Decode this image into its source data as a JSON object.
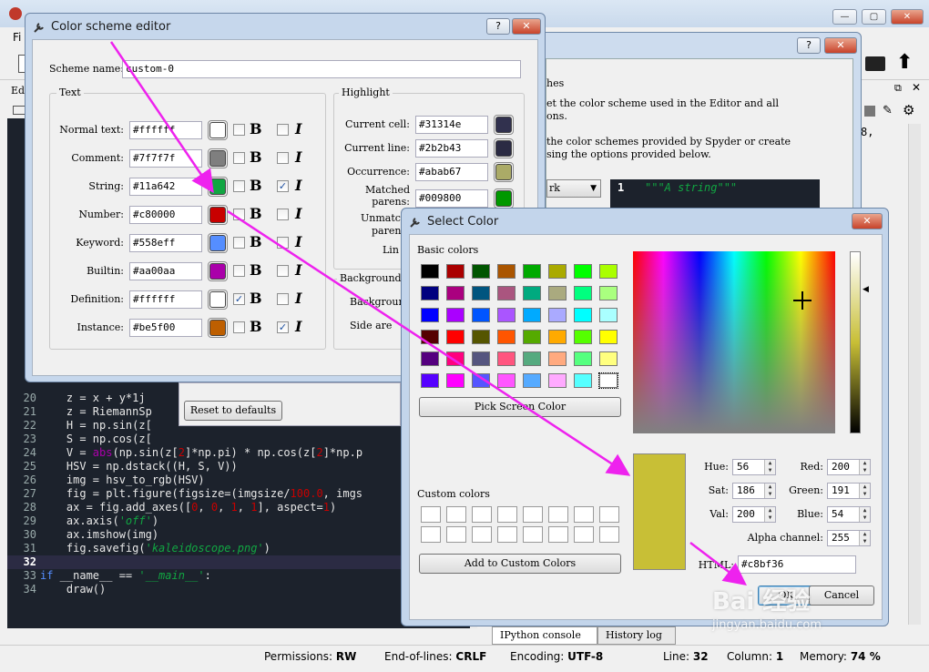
{
  "main": {
    "menu_partial": "Fi",
    "editor_tab_partial": "Edi",
    "right_text_fragment": "8,",
    "code_lines": [
      {
        "num": "20",
        "segs": [
          {
            "t": "    z = x + y*1j",
            "c": ""
          }
        ]
      },
      {
        "num": "21",
        "segs": [
          {
            "t": "    z = RiemannSp",
            "c": ""
          }
        ]
      },
      {
        "num": "22",
        "segs": [
          {
            "t": "    H = np.sin(z[",
            "c": ""
          }
        ]
      },
      {
        "num": "23",
        "segs": [
          {
            "t": "    S = np.cos(z[",
            "c": ""
          }
        ]
      },
      {
        "num": "24",
        "segs": [
          {
            "t": "    V = ",
            "c": ""
          },
          {
            "t": "abs",
            "c": "bi"
          },
          {
            "t": "(np.sin(z[",
            "c": ""
          },
          {
            "t": "2",
            "c": "num"
          },
          {
            "t": "]*np.pi) * np.cos(z[",
            "c": ""
          },
          {
            "t": "2",
            "c": "num"
          },
          {
            "t": "]*np.p",
            "c": ""
          }
        ]
      },
      {
        "num": "25",
        "segs": [
          {
            "t": "    HSV = np.dstack((H, S, V))",
            "c": ""
          }
        ]
      },
      {
        "num": "26",
        "segs": [
          {
            "t": "    img = hsv_to_rgb(HSV)",
            "c": ""
          }
        ]
      },
      {
        "num": "27",
        "segs": [
          {
            "t": "    fig = plt.figure(figsize=(imgsize/",
            "c": ""
          },
          {
            "t": "100.0",
            "c": "num"
          },
          {
            "t": ", imgs",
            "c": ""
          }
        ]
      },
      {
        "num": "28",
        "segs": [
          {
            "t": "    ax = fig.add_axes([",
            "c": ""
          },
          {
            "t": "0",
            "c": "num"
          },
          {
            "t": ", ",
            "c": ""
          },
          {
            "t": "0",
            "c": "num"
          },
          {
            "t": ", ",
            "c": ""
          },
          {
            "t": "1",
            "c": "num"
          },
          {
            "t": ", ",
            "c": ""
          },
          {
            "t": "1",
            "c": "num"
          },
          {
            "t": "], aspect=",
            "c": ""
          },
          {
            "t": "1",
            "c": "num"
          },
          {
            "t": ")",
            "c": ""
          }
        ]
      },
      {
        "num": "29",
        "segs": [
          {
            "t": "    ax.axis(",
            "c": ""
          },
          {
            "t": "'off'",
            "c": "str"
          },
          {
            "t": ")",
            "c": ""
          }
        ]
      },
      {
        "num": "30",
        "segs": [
          {
            "t": "    ax.imshow(img)",
            "c": ""
          }
        ]
      },
      {
        "num": "31",
        "segs": [
          {
            "t": "    fig.savefig(",
            "c": ""
          },
          {
            "t": "'kaleidoscope.png'",
            "c": "str"
          },
          {
            "t": ")",
            "c": ""
          }
        ]
      },
      {
        "num": "32",
        "segs": [
          {
            "t": "",
            "c": ""
          }
        ]
      },
      {
        "num": "33",
        "segs": [
          {
            "t": "if",
            "c": "kw"
          },
          {
            "t": " __name__ == ",
            "c": ""
          },
          {
            "t": "'__main__'",
            "c": "str"
          },
          {
            "t": ":",
            "c": ""
          }
        ]
      },
      {
        "num": "34",
        "segs": [
          {
            "t": "    draw()",
            "c": ""
          }
        ]
      }
    ],
    "console_tabs": [
      "IPython console",
      "History log"
    ],
    "status": {
      "permissions_label": "Permissions:",
      "permissions": "RW",
      "eol_label": "End-of-lines:",
      "eol": "CRLF",
      "encoding_label": "Encoding:",
      "encoding": "UTF-8",
      "line_label": "Line:",
      "line": "32",
      "column_label": "Column:",
      "column": "1",
      "memory_label": "Memory:",
      "memory": "74 %"
    }
  },
  "prefs": {
    "help_btn": "?",
    "close_btn": "✕",
    "partial_lines": [
      "hes",
      "et the color scheme used in the Editor and all",
      "ons.",
      "the color schemes provided by Spyder or create",
      "sing the options provided below."
    ],
    "scheme_select_partial": "rk",
    "preview_line_num": "1",
    "preview_code": "\"\"\"A string\"\"\"",
    "reset_button": "Reset to defaults"
  },
  "cse": {
    "title": "Color scheme editor",
    "help_btn": "?",
    "close_btn": "✕",
    "scheme_name_label": "Scheme name:",
    "scheme_name": "custom-0",
    "text_group": "Text",
    "bold_glyph": "B",
    "italic_glyph": "I",
    "check_glyph": "✓",
    "text_rows": [
      {
        "label": "Normal text:",
        "value": "#ffffff",
        "color": "#ffffff",
        "bold": false,
        "italic": false
      },
      {
        "label": "Comment:",
        "value": "#7f7f7f",
        "color": "#7f7f7f",
        "bold": false,
        "italic": false
      },
      {
        "label": "String:",
        "value": "#11a642",
        "color": "#11a642",
        "bold": false,
        "italic": true
      },
      {
        "label": "Number:",
        "value": "#c80000",
        "color": "#c80000",
        "bold": false,
        "italic": false
      },
      {
        "label": "Keyword:",
        "value": "#558eff",
        "color": "#558eff",
        "bold": false,
        "italic": false
      },
      {
        "label": "Builtin:",
        "value": "#aa00aa",
        "color": "#aa00aa",
        "bold": false,
        "italic": false
      },
      {
        "label": "Definition:",
        "value": "#ffffff",
        "color": "#ffffff",
        "bold": true,
        "italic": false
      },
      {
        "label": "Instance:",
        "value": "#be5f00",
        "color": "#be5f00",
        "bold": false,
        "italic": true
      }
    ],
    "highlight_group": "Highlight",
    "highlight_rows": [
      {
        "label": "Current cell:",
        "value": "#31314e",
        "color": "#31314e"
      },
      {
        "label": "Current line:",
        "value": "#2b2b43",
        "color": "#2b2b43"
      },
      {
        "label": "Occurrence:",
        "value": "#abab67",
        "color": "#abab67"
      },
      {
        "label1": "Matched",
        "label2": "parens:",
        "value": "#009800",
        "color": "#009800"
      }
    ],
    "unmatched_partial_1": "Unmatch",
    "unmatched_partial_2": "paren",
    "link_partial": "Lin",
    "background_group_partial": "Background",
    "background_label_partial": "Backgroun",
    "side_area_partial": "Side are"
  },
  "scd": {
    "title": "Select Color",
    "close_btn": "✕",
    "basic_colors_label": "Basic colors",
    "basic_colors": [
      [
        "#000000",
        "#aa0000",
        "#005500",
        "#aa5500",
        "#00aa00",
        "#aaaa00",
        "#00ff00",
        "#aaff00"
      ],
      [
        "#00007f",
        "#aa007f",
        "#00557f",
        "#aa557f",
        "#00aa7f",
        "#aaaa7f",
        "#00ff7f",
        "#aaff7f"
      ],
      [
        "#0000ff",
        "#aa00ff",
        "#0055ff",
        "#aa55ff",
        "#00aaff",
        "#aaaaff",
        "#00ffff",
        "#aaffff"
      ],
      [
        "#550000",
        "#ff0000",
        "#555500",
        "#ff5500",
        "#55aa00",
        "#ffaa00",
        "#55ff00",
        "#ffff00"
      ],
      [
        "#55007f",
        "#ff007f",
        "#55557f",
        "#ff557f",
        "#55aa7f",
        "#ffaa7f",
        "#55ff7f",
        "#ffff7f"
      ],
      [
        "#5500ff",
        "#ff00ff",
        "#5555ff",
        "#ff55ff",
        "#55aaff",
        "#ffaaff",
        "#55ffff",
        "#ffffff"
      ]
    ],
    "pick_screen_button": "Pick Screen Color",
    "custom_colors_label": "Custom colors",
    "add_custom_button": "Add to Custom Colors",
    "current_color": "#c8bf36",
    "hue_label": "Hue:",
    "hue": "56",
    "sat_label": "Sat:",
    "sat": "186",
    "val_label": "Val:",
    "val": "200",
    "red_label": "Red:",
    "red": "200",
    "green_label": "Green:",
    "green": "191",
    "blue_label": "Blue:",
    "blue": "54",
    "alpha_label": "Alpha channel:",
    "alpha": "255",
    "html_label": "HTML:",
    "html": "#c8bf36",
    "ok_button": "OK",
    "cancel_button": "Cancel"
  },
  "watermark": {
    "text": "Bai 经验",
    "url": "jingyan.baidu.com"
  },
  "colors": {
    "arrow": "#ee22ee",
    "editor_bg": "#1c222c"
  }
}
